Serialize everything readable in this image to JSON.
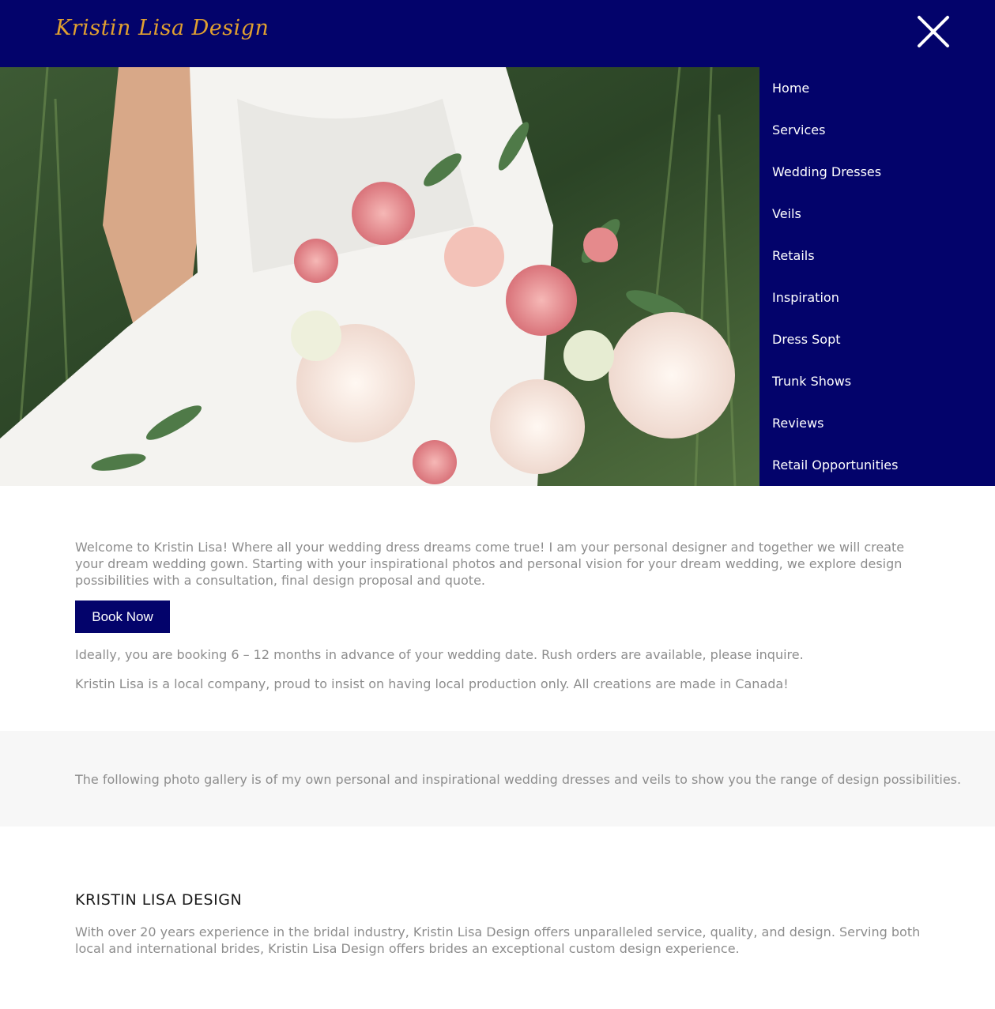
{
  "header": {
    "logo": "Kristin Lisa Design",
    "close_icon": "close-icon"
  },
  "colors": {
    "nav_bg": "#03036b",
    "logo": "#e0a030",
    "body_text": "#8d8d8d",
    "gallery_bg": "#f7f7f7"
  },
  "hero": {
    "image": "bride-bouquet-photo"
  },
  "nav": {
    "items": [
      {
        "label": "Home"
      },
      {
        "label": "Services"
      },
      {
        "label": "Wedding Dresses"
      },
      {
        "label": "Veils"
      },
      {
        "label": "Retails"
      },
      {
        "label": "Inspiration"
      },
      {
        "label": "Dress Sopt"
      },
      {
        "label": "Trunk Shows"
      },
      {
        "label": "Reviews"
      },
      {
        "label": "Retail Opportunities"
      }
    ]
  },
  "intro": {
    "text": "Welcome to Kristin Lisa! Where all your wedding dress dreams come true! I am your personal designer and together we will create your dream wedding gown.  Starting with your inspirational photos and personal vision for your dream wedding, we explore design possibilities with a consultation, final design proposal and quote.",
    "book_button": "Book Now",
    "booking_note": "Ideally, you are booking 6 – 12 months in advance of your wedding date. Rush orders are available, please inquire.",
    "local_note": "Kristin Lisa is a local company, proud to insist on having local production only.  All creations are made in Canada!"
  },
  "gallery": {
    "text": "The following photo gallery is of my own personal and inspirational wedding dresses and veils to show you the range of design possibilities."
  },
  "about": {
    "title": "KRISTIN LISA DESIGN",
    "text": "With over 20 years experience in the bridal industry, Kristin Lisa Design offers unparalleled service, quality, and design. Serving both local and international brides, Kristin Lisa Design offers brides an exceptional custom design experience."
  }
}
